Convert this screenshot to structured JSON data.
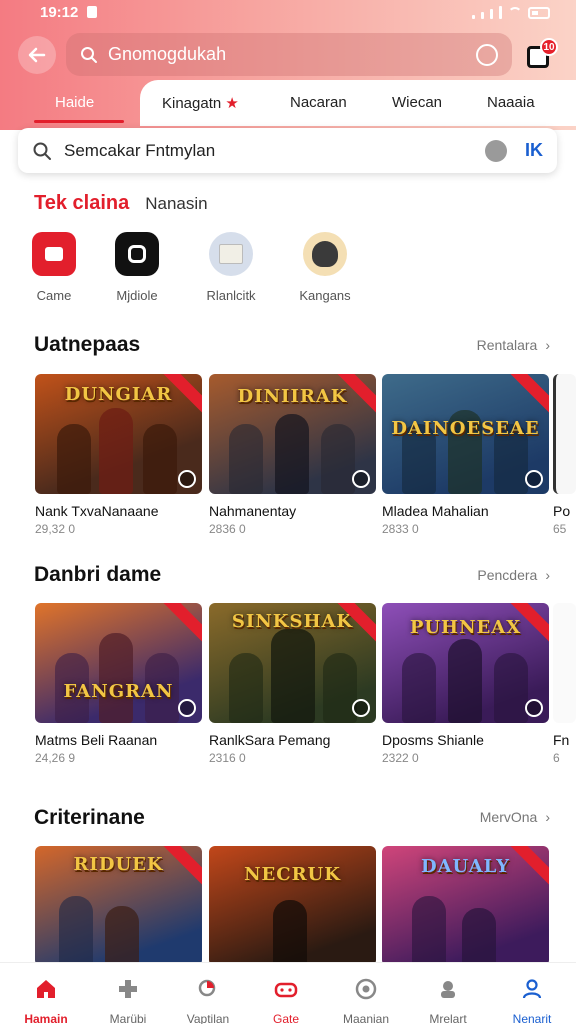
{
  "status": {
    "time": "19:12"
  },
  "header": {
    "search_text": "Gnomogdukah",
    "notif_count": "10"
  },
  "tabs": [
    {
      "label": "Haide"
    },
    {
      "label": "Kinagatn"
    },
    {
      "label": "Nacaran"
    },
    {
      "label": "Wiecan"
    },
    {
      "label": "Naaaia"
    }
  ],
  "search": {
    "text": "Semcakar Fntmylan",
    "scan_label": "IK"
  },
  "category": {
    "active": "Tek claina",
    "other": "Nanasin"
  },
  "quick": [
    {
      "label": "Came",
      "color": "#e21f2c",
      "icon": "game-icon"
    },
    {
      "label": "Mjdiole",
      "color": "#111111",
      "icon": "media-icon"
    },
    {
      "label": "Rlanlcitk",
      "color": "#cfd8e6",
      "icon": "ranking-icon"
    },
    {
      "label": "Kangans",
      "color": "#f4d9a8",
      "icon": "avatar-icon"
    }
  ],
  "sections": [
    {
      "title": "Uatnepaas",
      "more": "Rentalara",
      "cards": [
        {
          "title": "Nank TxvaNanaane",
          "meta": "29,32 0",
          "art": "DUNGIAR",
          "c1": "#4a2a1c",
          "c2": "#c1521a"
        },
        {
          "title": "Nahmanentay",
          "meta": "2836 0",
          "art": "DINIIRAK",
          "c1": "#2e3446",
          "c2": "#a75b2d"
        },
        {
          "title": "Mladea Mahalian",
          "meta": "2833 0",
          "art": "DAINOESEAE",
          "c1": "#1d3a66",
          "c2": "#3e6b8a"
        },
        {
          "title": "Po",
          "meta": "65",
          "art": "",
          "c1": "#3a3a3a",
          "c2": "#666666"
        }
      ]
    },
    {
      "title": "Danbri dame",
      "more": "Pencdera",
      "cards": [
        {
          "title": "Matms Beli Raanan",
          "meta": "24,26 9",
          "art": "FANGRAN",
          "c1": "#3b2a6b",
          "c2": "#e0742a"
        },
        {
          "title": "RanlkSara Pemang",
          "meta": "2316 0",
          "art": "SINKSHAK",
          "c1": "#2c3a22",
          "c2": "#8a6a2a"
        },
        {
          "title": "Dposms Shianle",
          "meta": "2322 0",
          "art": "PUHNEAX",
          "c1": "#3a1b58",
          "c2": "#8e4fb8"
        },
        {
          "title": "Fn",
          "meta": "6",
          "art": "",
          "c1": "#3a3a3a",
          "c2": "#666666"
        }
      ]
    },
    {
      "title": "Criterinane",
      "more": "MervOna",
      "cards": [
        {
          "title": "",
          "meta": "",
          "art": "RIDUEK",
          "c1": "#1f3a6e",
          "c2": "#d4672a"
        },
        {
          "title": "",
          "meta": "",
          "art": "NECRUK",
          "c1": "#2a1a12",
          "c2": "#c2471a"
        },
        {
          "title": "",
          "meta": "",
          "art": "DAUALY",
          "c1": "#3d1b5c",
          "c2": "#d0457a"
        }
      ]
    }
  ],
  "bottom_nav": [
    {
      "label": "Hamain",
      "active": true
    },
    {
      "label": "Marübi"
    },
    {
      "label": "Vaptilan"
    },
    {
      "label": "Gate"
    },
    {
      "label": "Maanian"
    },
    {
      "label": "Mrelart"
    },
    {
      "label": "Nenarit"
    }
  ],
  "colors": {
    "accent": "#e21f2c",
    "link_blue": "#1a5fd0"
  }
}
